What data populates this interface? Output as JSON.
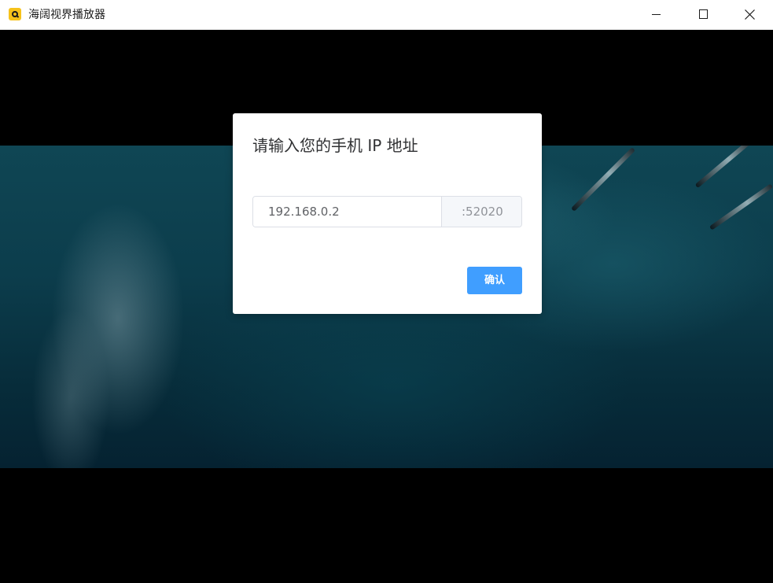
{
  "window": {
    "title": "海阔视界播放器",
    "icon": "app-icon"
  },
  "dialog": {
    "title": "请输入您的手机 IP 地址",
    "ip_value": "192.168.0.2",
    "port_suffix": ":52020",
    "confirm_label": "确认"
  },
  "colors": {
    "titlebar_bg": "#ffffff",
    "player_bg": "#000000",
    "dialog_bg": "#ffffff",
    "primary_button": "#409eff",
    "append_bg": "#f5f7fa"
  }
}
